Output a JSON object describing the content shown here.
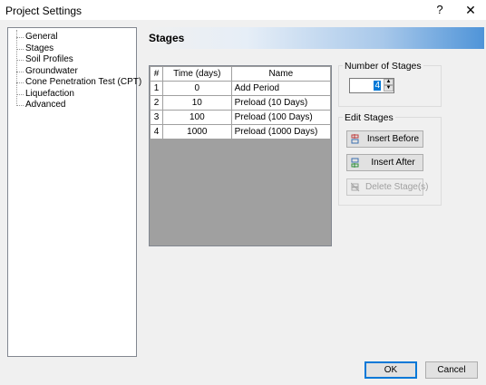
{
  "window": {
    "title": "Project Settings",
    "help": "?",
    "close": "✕"
  },
  "tree": {
    "items": [
      "General",
      "Stages",
      "Soil Profiles",
      "Groundwater",
      "Cone Penetration Test (CPT)",
      "Liquefaction",
      "Advanced"
    ]
  },
  "section_title": "Stages",
  "table": {
    "headers": [
      "#",
      "Time (days)",
      "Name"
    ],
    "rows": [
      [
        "1",
        "0",
        "Add Period"
      ],
      [
        "2",
        "10",
        "Preload (10 Days)"
      ],
      [
        "3",
        "100",
        "Preload (100 Days)"
      ],
      [
        "4",
        "1000",
        "Preload (1000 Days)"
      ]
    ]
  },
  "number_of_stages": {
    "label": "Number of Stages",
    "value": "4"
  },
  "edit_stages": {
    "label": "Edit Stages",
    "insert_before": "Insert Before",
    "insert_after": "Insert After",
    "delete_stage": "Delete Stage(s)"
  },
  "footer": {
    "ok": "OK",
    "cancel": "Cancel"
  }
}
